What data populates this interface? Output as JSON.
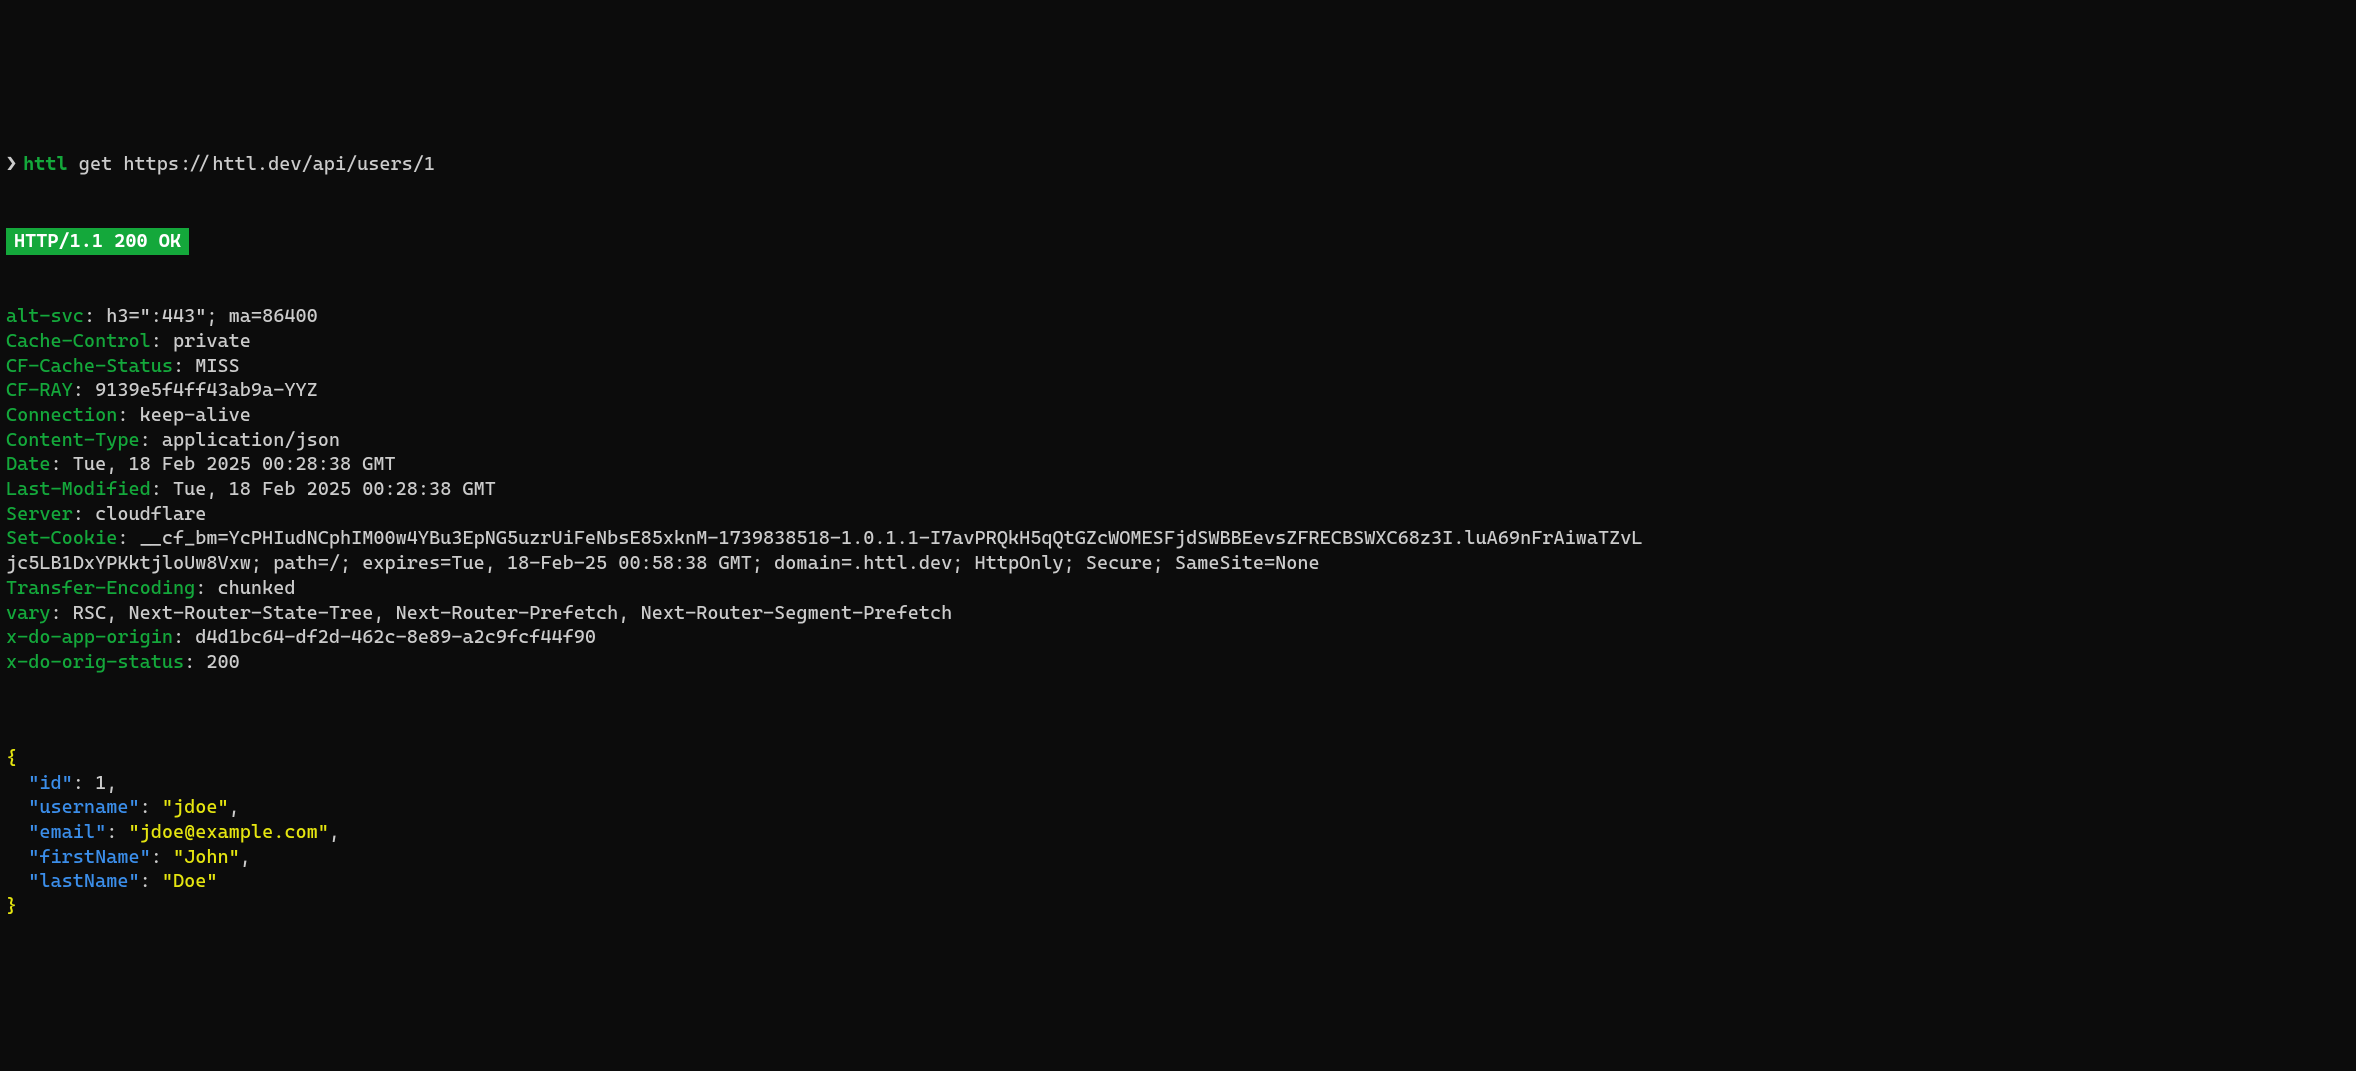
{
  "prompt": {
    "symbol": "❯",
    "command": "httl",
    "args": " get https://httl.dev/api/users/1"
  },
  "status": "HTTP/1.1 200 OK",
  "headers": [
    {
      "key": "alt-svc",
      "value": "h3=\":443\"; ma=86400"
    },
    {
      "key": "Cache-Control",
      "value": "private"
    },
    {
      "key": "CF-Cache-Status",
      "value": "MISS"
    },
    {
      "key": "CF-RAY",
      "value": "9139e5f4ff43ab9a-YYZ"
    },
    {
      "key": "Connection",
      "value": "keep-alive"
    },
    {
      "key": "Content-Type",
      "value": "application/json"
    },
    {
      "key": "Date",
      "value": "Tue, 18 Feb 2025 00:28:38 GMT"
    },
    {
      "key": "Last-Modified",
      "value": "Tue, 18 Feb 2025 00:28:38 GMT"
    },
    {
      "key": "Server",
      "value": "cloudflare"
    },
    {
      "key": "Set-Cookie",
      "value": "__cf_bm=YcPHIudNCphIM00w4YBu3EpNG5uzrUiFeNbsE85xknM-1739838518-1.0.1.1-I7avPRQkH5qQtGZcWOMESFjdSWBBEevsZFRECBSWXC68z3I.luA69nFrAiwaTZvL",
      "cont": "jc5LB1DxYPKktjloUw8Vxw; path=/; expires=Tue, 18-Feb-25 00:58:38 GMT; domain=.httl.dev; HttpOnly; Secure; SameSite=None"
    },
    {
      "key": "Transfer-Encoding",
      "value": "chunked"
    },
    {
      "key": "vary",
      "value": "RSC, Next-Router-State-Tree, Next-Router-Prefetch, Next-Router-Segment-Prefetch"
    },
    {
      "key": "x-do-app-origin",
      "value": "d4d1bc64-df2d-462c-8e89-a2c9fcf44f90"
    },
    {
      "key": "x-do-orig-status",
      "value": "200"
    }
  ],
  "body": {
    "open": "{",
    "close": "}",
    "lines": [
      {
        "indent": "  ",
        "key": "\"id\"",
        "sep": ": ",
        "val": "1",
        "type": "num",
        "comma": ","
      },
      {
        "indent": "  ",
        "key": "\"username\"",
        "sep": ": ",
        "val": "\"jdoe\"",
        "type": "str",
        "comma": ","
      },
      {
        "indent": "  ",
        "key": "\"email\"",
        "sep": ": ",
        "val": "\"jdoe@example.com\"",
        "type": "str",
        "comma": ","
      },
      {
        "indent": "  ",
        "key": "\"firstName\"",
        "sep": ": ",
        "val": "\"John\"",
        "type": "str",
        "comma": ","
      },
      {
        "indent": "  ",
        "key": "\"lastName\"",
        "sep": ": ",
        "val": "\"Doe\"",
        "type": "str",
        "comma": ""
      }
    ]
  }
}
